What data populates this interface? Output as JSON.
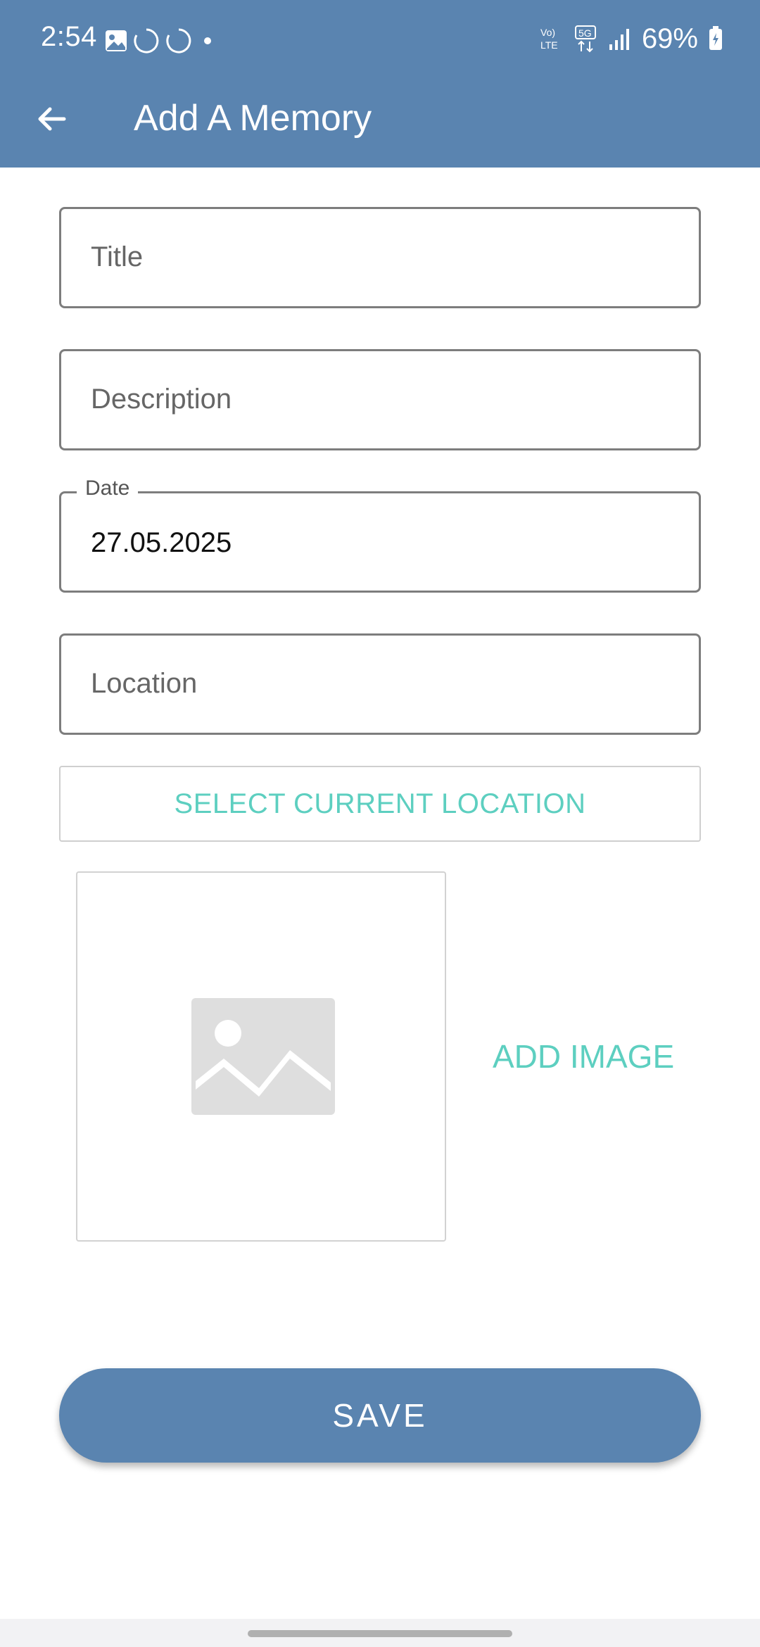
{
  "status_bar": {
    "time": "2:54",
    "battery": "69%",
    "network_label": "Vo) LTE",
    "fiveg_label": "5G",
    "icons": [
      "gallery-icon",
      "loading-icon",
      "loading-icon",
      "dot-icon",
      "volte-icon",
      "5g-icon",
      "signal-icon",
      "battery-charging-icon"
    ]
  },
  "app_bar": {
    "title": "Add A Memory",
    "back_icon": "arrow-left-icon",
    "color": "#5a84b0"
  },
  "form": {
    "title_placeholder": "Title",
    "description_placeholder": "Description",
    "date_label": "Date",
    "date_value": "27.05.2025",
    "location_placeholder": "Location",
    "select_location_label": "SELECT CURRENT LOCATION",
    "add_image_label": "ADD IMAGE",
    "image_placeholder_icon": "image-placeholder-icon",
    "save_label": "SAVE"
  },
  "colors": {
    "primary": "#5a84b0",
    "accent": "#5dcfc0"
  }
}
